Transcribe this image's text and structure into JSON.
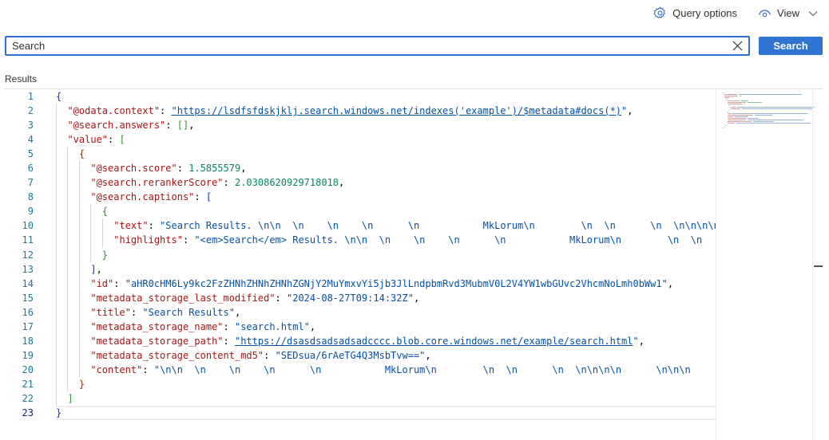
{
  "toolbar": {
    "query_options_label": "Query options",
    "query_options_icon": "gear-icon",
    "view_label": "View",
    "view_icon": "eye-icon"
  },
  "search": {
    "value": "Search",
    "button_label": "Search",
    "accent": "#2f73d3"
  },
  "results": {
    "label": "Results",
    "active_line": 23,
    "lines": [
      [
        [
          "b1",
          "{"
        ]
      ],
      [
        [
          "p",
          "  "
        ],
        [
          "key",
          "\"@odata.context\""
        ],
        [
          "p",
          ": "
        ],
        [
          "link",
          "\"https://lsdfsfdskjklj.search.windows.net/indexes('example')/$metadata#docs(*)"
        ],
        [
          "str",
          "\""
        ],
        [
          "p",
          ","
        ]
      ],
      [
        [
          "p",
          "  "
        ],
        [
          "key",
          "\"@search.answers\""
        ],
        [
          "p",
          ": "
        ],
        [
          "b2",
          "[]"
        ],
        [
          "p",
          ","
        ]
      ],
      [
        [
          "p",
          "  "
        ],
        [
          "key",
          "\"value\""
        ],
        [
          "p",
          ": "
        ],
        [
          "b2",
          "["
        ]
      ],
      [
        [
          "p",
          "    "
        ],
        [
          "b3",
          "{"
        ]
      ],
      [
        [
          "p",
          "      "
        ],
        [
          "key",
          "\"@search.score\""
        ],
        [
          "p",
          ": "
        ],
        [
          "num",
          "1.5855579"
        ],
        [
          "p",
          ","
        ]
      ],
      [
        [
          "p",
          "      "
        ],
        [
          "key",
          "\"@search.rerankerScore\""
        ],
        [
          "p",
          ": "
        ],
        [
          "num",
          "2.0308620929718018"
        ],
        [
          "p",
          ","
        ]
      ],
      [
        [
          "p",
          "      "
        ],
        [
          "key",
          "\"@search.captions\""
        ],
        [
          "p",
          ": "
        ],
        [
          "b1",
          "["
        ]
      ],
      [
        [
          "p",
          "        "
        ],
        [
          "b2",
          "{"
        ]
      ],
      [
        [
          "p",
          "          "
        ],
        [
          "key",
          "\"text\""
        ],
        [
          "p",
          ": "
        ],
        [
          "str",
          "\"Search Results. \\n\\n  \\n    \\n    \\n      \\n           MkLorum\\n        \\n  \\n      \\n  \\n\\n\\n\\n"
        ]
      ],
      [
        [
          "p",
          "          "
        ],
        [
          "key",
          "\"highlights\""
        ],
        [
          "p",
          ": "
        ],
        [
          "str",
          "\"<em>Search</em> Results. \\n\\n  \\n    \\n    \\n      \\n           MkLorum\\n        \\n  \\n"
        ]
      ],
      [
        [
          "p",
          "        "
        ],
        [
          "b2",
          "}"
        ]
      ],
      [
        [
          "p",
          "      "
        ],
        [
          "b1",
          "]"
        ],
        [
          "p",
          ","
        ]
      ],
      [
        [
          "p",
          "      "
        ],
        [
          "key",
          "\"id\""
        ],
        [
          "p",
          ": "
        ],
        [
          "str",
          "\"aHR0cHM6Ly9kc2FzZHNhZHNhZHNhZGNjY2MuYmxvYi5jb3JlLndpbmRvd3MubmV0L2V4YW1wbGUvc2VhcmNoLmh0bWw1\""
        ],
        [
          "p",
          ","
        ]
      ],
      [
        [
          "p",
          "      "
        ],
        [
          "key",
          "\"metadata_storage_last_modified\""
        ],
        [
          "p",
          ": "
        ],
        [
          "str",
          "\"2024-08-27T09:14:32Z\""
        ],
        [
          "p",
          ","
        ]
      ],
      [
        [
          "p",
          "      "
        ],
        [
          "key",
          "\"title\""
        ],
        [
          "p",
          ": "
        ],
        [
          "str",
          "\"Search Results\""
        ],
        [
          "p",
          ","
        ]
      ],
      [
        [
          "p",
          "      "
        ],
        [
          "key",
          "\"metadata_storage_name\""
        ],
        [
          "p",
          ": "
        ],
        [
          "str",
          "\"search.html\""
        ],
        [
          "p",
          ","
        ]
      ],
      [
        [
          "p",
          "      "
        ],
        [
          "key",
          "\"metadata_storage_path\""
        ],
        [
          "p",
          ": "
        ],
        [
          "link",
          "\"https://dsasdsadsadsadcccc.blob.core.windows.net/example/search.html"
        ],
        [
          "str",
          "\""
        ],
        [
          "p",
          ","
        ]
      ],
      [
        [
          "p",
          "      "
        ],
        [
          "key",
          "\"metadata_storage_content_md5\""
        ],
        [
          "p",
          ": "
        ],
        [
          "str",
          "\"SEDsua/6rAeTG4Q3MsbTvw==\""
        ],
        [
          "p",
          ","
        ]
      ],
      [
        [
          "p",
          "      "
        ],
        [
          "key",
          "\"content\""
        ],
        [
          "p",
          ": "
        ],
        [
          "str",
          "\"\\n\\n  \\n    \\n    \\n      \\n           MkLorum\\n        \\n  \\n      \\n  \\n\\n\\n\\n      \\n\\n\\n"
        ]
      ],
      [
        [
          "p",
          "    "
        ],
        [
          "b3",
          "}"
        ]
      ],
      [
        [
          "p",
          "  "
        ],
        [
          "b2",
          "]"
        ]
      ],
      [
        [
          "b1",
          "}"
        ]
      ]
    ]
  },
  "colors": {
    "key": "#a31515",
    "string": "#0451a5",
    "number": "#098658",
    "line_number": "#237893"
  }
}
